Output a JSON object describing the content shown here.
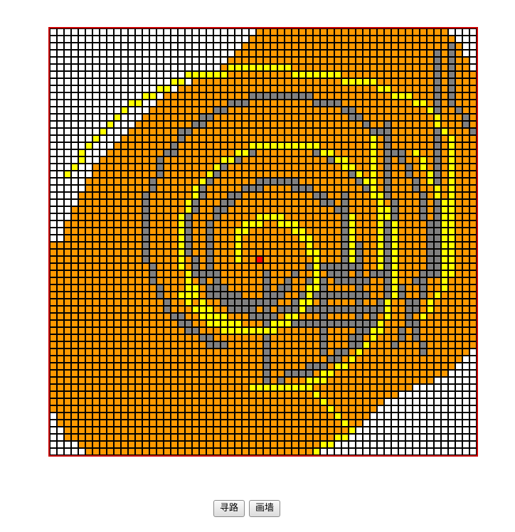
{
  "grid": {
    "cols": 60,
    "rows": 60,
    "colors": {
      "empty": "#ffffff",
      "explored": "#ff9900",
      "path": "#ffff00",
      "wall": "#808080",
      "start": "#ff0000",
      "cell_border": "#000000",
      "frame": "#cc0000"
    },
    "explored_rows": [
      [
        29,
        55
      ],
      [
        28,
        56
      ],
      [
        27,
        57
      ],
      [
        26,
        57
      ],
      [
        25,
        58
      ],
      [
        24,
        58
      ],
      [
        22,
        59
      ],
      [
        20,
        59
      ],
      [
        18,
        59
      ],
      [
        16,
        59
      ],
      [
        15,
        59
      ],
      [
        14,
        59
      ],
      [
        13,
        59
      ],
      [
        12,
        59
      ],
      [
        11,
        59
      ],
      [
        10,
        59
      ],
      [
        9,
        59
      ],
      [
        8,
        59
      ],
      [
        7,
        59
      ],
      [
        6,
        59
      ],
      [
        6,
        59
      ],
      [
        5,
        59
      ],
      [
        5,
        59
      ],
      [
        4,
        59
      ],
      [
        4,
        59
      ],
      [
        3,
        59
      ],
      [
        3,
        59
      ],
      [
        2,
        59
      ],
      [
        2,
        59
      ],
      [
        2,
        59
      ],
      [
        0,
        59
      ],
      [
        0,
        59
      ],
      [
        0,
        59
      ],
      [
        0,
        59
      ],
      [
        0,
        59
      ],
      [
        0,
        59
      ],
      [
        0,
        59
      ],
      [
        0,
        59
      ],
      [
        0,
        59
      ],
      [
        0,
        59
      ],
      [
        0,
        59
      ],
      [
        0,
        59
      ],
      [
        0,
        59
      ],
      [
        0,
        59
      ],
      [
        0,
        59
      ],
      [
        0,
        58
      ],
      [
        0,
        57
      ],
      [
        0,
        56
      ],
      [
        0,
        55
      ],
      [
        0,
        53
      ],
      [
        0,
        50
      ],
      [
        0,
        48
      ],
      [
        0,
        46
      ],
      [
        0,
        45
      ],
      [
        1,
        44
      ],
      [
        1,
        43
      ],
      [
        2,
        42
      ],
      [
        2,
        41
      ],
      [
        4,
        39
      ],
      [
        5,
        37
      ]
    ],
    "start_cell": [
      29,
      32
    ]
  },
  "buttons": {
    "find_path": "寻路",
    "draw_wall": "画墙"
  }
}
